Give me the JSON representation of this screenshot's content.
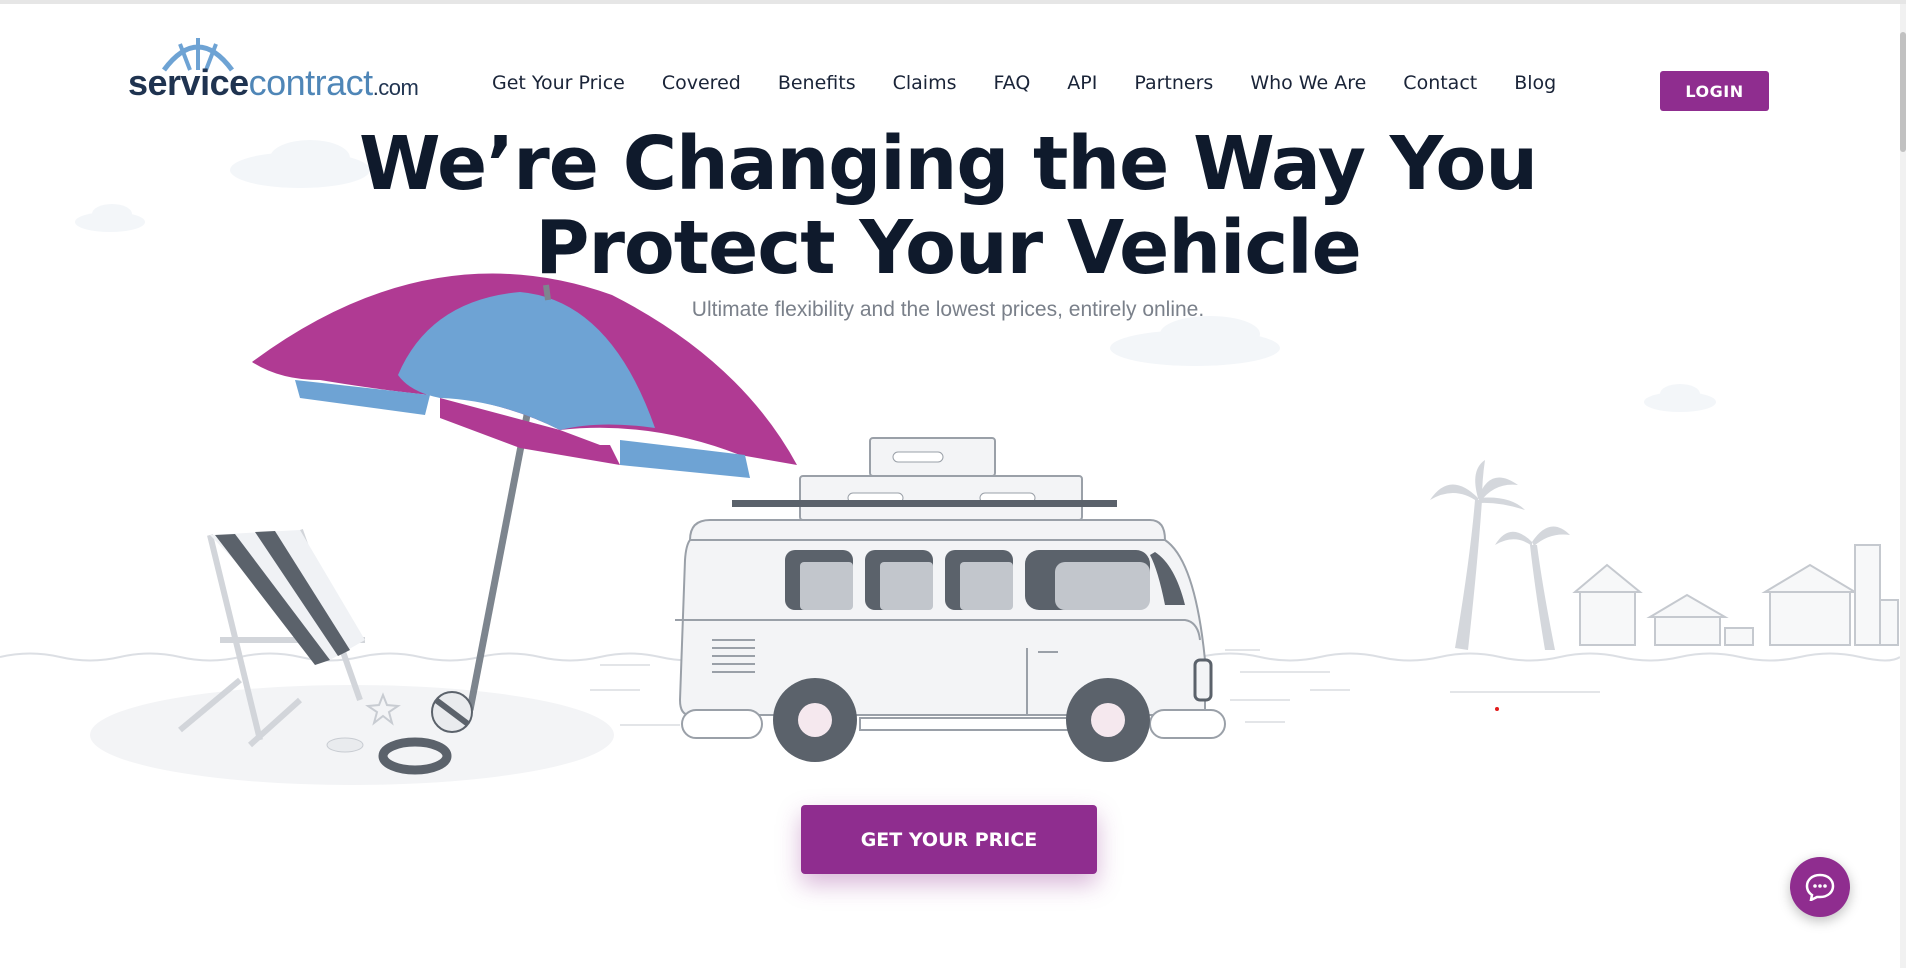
{
  "logo": {
    "part1": "service",
    "part2": "contract",
    "part3": ".com"
  },
  "nav": {
    "items": [
      "Get Your Price",
      "Covered",
      "Benefits",
      "Claims",
      "FAQ",
      "API",
      "Partners",
      "Who We Are",
      "Contact",
      "Blog"
    ],
    "login_label": "LOGIN"
  },
  "hero": {
    "title_line1": "We’re Changing the Way You",
    "title_line2": "Protect Your Vehicle",
    "subtitle": "Ultimate flexibility and the lowest prices, entirely online."
  },
  "cta": {
    "label": "GET YOUR PRICE"
  },
  "chat": {
    "icon": "chat-bubble-icon"
  },
  "colors": {
    "brand": "#8f2d8f",
    "umbrella_blue": "#6ea3d4",
    "umbrella_pink": "#b03a93",
    "title": "#0f1a2c"
  }
}
